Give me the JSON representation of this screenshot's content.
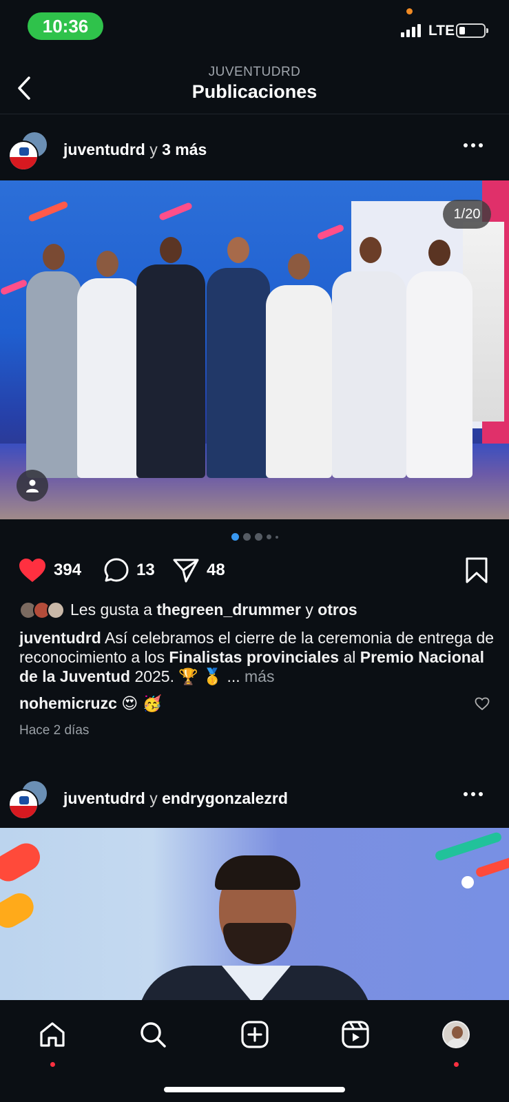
{
  "status_bar": {
    "time": "10:36",
    "network": "LTE"
  },
  "header": {
    "account": "JUVENTUDRD",
    "title": "Publicaciones"
  },
  "posts": [
    {
      "user": "juventudrd",
      "connector": "y",
      "coauthors": "3 más",
      "image_counter": "1/20",
      "likes": "394",
      "comments": "13",
      "shares": "48",
      "liked_by_prefix": "Les gusta a",
      "liked_by_user": "thegreen_drummer",
      "liked_by_conj": "y",
      "liked_by_others": "otros",
      "caption_user": "juventudrd",
      "caption_text_1": "Así celebramos el cierre de la ceremonia de entrega de reconocimiento a los",
      "caption_bold_1": "Finalistas provinciales",
      "caption_text_2": "al",
      "caption_bold_2": "Premio Nacional de la Juventud",
      "caption_text_3": "2025. 🏆 🥇 ...",
      "caption_more": "más",
      "top_comment_user": "nohemicruzc",
      "top_comment_text": "😍 🥳",
      "time_ago": "Hace 2 días",
      "carousel_dots": 5
    },
    {
      "user": "juventudrd",
      "connector": "y",
      "coauthors": "endrygonzalezrd"
    }
  ],
  "colors": {
    "background": "#0b0f14",
    "like_red": "#ff3040",
    "active_dot": "#3897f0",
    "status_green": "#2fc24b"
  },
  "tabbar": {
    "items": [
      "home-icon",
      "search-icon",
      "create-icon",
      "reels-icon",
      "profile-avatar"
    ]
  }
}
